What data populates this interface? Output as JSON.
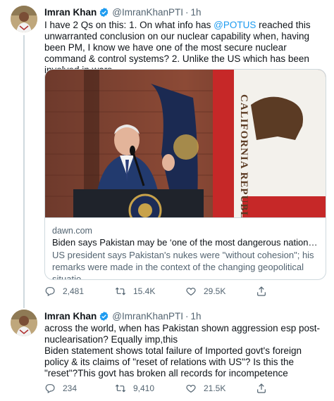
{
  "tweets": [
    {
      "author_name": "Imran Khan",
      "handle": "@ImranKhanPTI",
      "separator": "·",
      "time": "1h",
      "text_before_mention": "I have 2 Qs on this: 1. On what info has ",
      "mention": "@POTUS",
      "text_after_mention": " reached this unwarranted conclusion on our nuclear capability when, having been PM, I know we have one of the most secure nuclear command & control systems? 2. Unlike the US which has been involved in wars",
      "card": {
        "domain": "dawn.com",
        "title": "Biden says Pakistan may be ‘one of the most dangerous nations in the...",
        "description": "US president says Pakistan's nukes were \"without cohesion\"; his remarks were made in the context of the changing geopolitical situatio..."
      },
      "stats": {
        "replies": "2,481",
        "retweets": "15.4K",
        "likes": "29.5K"
      }
    },
    {
      "author_name": "Imran Khan",
      "handle": "@ImranKhanPTI",
      "separator": "·",
      "time": "1h",
      "text": "across the world, when has Pakistan shown aggression esp post-nuclearisation? Equally imp,this\nBiden statement shows total failure of Imported govt's foreign policy & its claims of \"reset of relations with US\"? Is this the \"reset\"?This govt has broken all records for incompetence",
      "stats": {
        "replies": "234",
        "retweets": "9,410",
        "likes": "21.5K"
      }
    }
  ],
  "flag_text": "CALIFORNIA REPUBLIC",
  "colors": {
    "link": "#1d9bf0",
    "verified": "#1d9bf0",
    "secondary_text": "#536471",
    "border": "#cfd9de"
  },
  "icons": [
    "verified-badge-icon",
    "reply-icon",
    "retweet-icon",
    "like-icon",
    "share-icon"
  ]
}
